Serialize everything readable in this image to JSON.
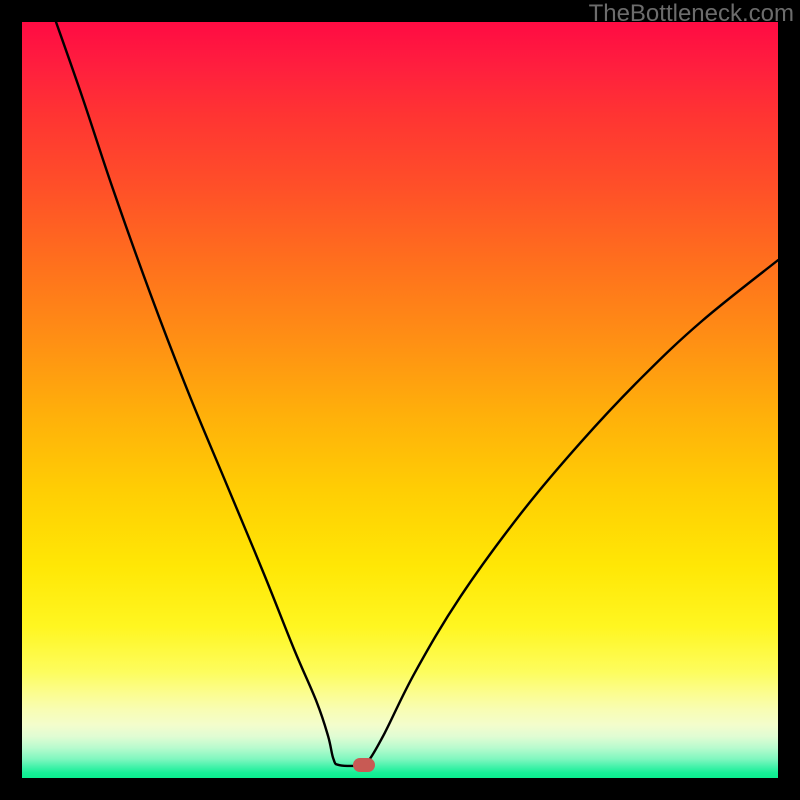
{
  "watermark": "TheBottleneck.com",
  "colors": {
    "curve": "#000000",
    "marker": "#c85a54",
    "frame": "#000000"
  },
  "chart_data": {
    "type": "line",
    "title": "",
    "xlabel": "",
    "ylabel": "",
    "xlim": [
      0,
      100
    ],
    "ylim": [
      0,
      100
    ],
    "note": "Bottleneck-style V curve. X is normalized horizontal position (0=left,100=right), Y is normalized vertical position (0=top,100=bottom) in the colored plot area.",
    "series": [
      {
        "name": "bottleneck-curve",
        "points": [
          {
            "x": 4.5,
            "y": 0.0
          },
          {
            "x": 8.0,
            "y": 10.0
          },
          {
            "x": 12.0,
            "y": 22.0
          },
          {
            "x": 17.0,
            "y": 36.0
          },
          {
            "x": 22.0,
            "y": 49.0
          },
          {
            "x": 27.0,
            "y": 61.0
          },
          {
            "x": 32.0,
            "y": 73.0
          },
          {
            "x": 36.0,
            "y": 83.0
          },
          {
            "x": 39.0,
            "y": 90.0
          },
          {
            "x": 40.5,
            "y": 94.5
          },
          {
            "x": 41.2,
            "y": 97.5
          },
          {
            "x": 42.0,
            "y": 98.3
          },
          {
            "x": 45.0,
            "y": 98.3
          },
          {
            "x": 46.0,
            "y": 97.5
          },
          {
            "x": 48.0,
            "y": 94.0
          },
          {
            "x": 52.0,
            "y": 86.0
          },
          {
            "x": 58.0,
            "y": 76.0
          },
          {
            "x": 66.0,
            "y": 65.0
          },
          {
            "x": 74.0,
            "y": 55.5
          },
          {
            "x": 82.0,
            "y": 47.0
          },
          {
            "x": 90.0,
            "y": 39.5
          },
          {
            "x": 100.0,
            "y": 31.5
          }
        ]
      }
    ],
    "marker": {
      "x": 45.3,
      "y": 98.3
    }
  }
}
